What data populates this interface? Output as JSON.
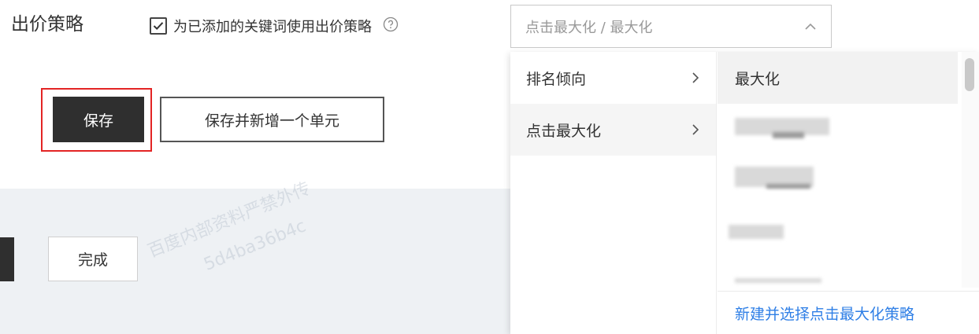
{
  "bid_strategy": {
    "section_label": "出价策略",
    "checkbox_label": "为已添加的关键词使用出价策略",
    "checkbox_checked": true,
    "select_value": "点击最大化 / 最大化"
  },
  "actions": {
    "save_label": "保存",
    "save_add_label": "保存并新增一个单元",
    "done_label": "完成"
  },
  "dropdown": {
    "categories": [
      {
        "label": "排名倾向"
      },
      {
        "label": "点击最大化"
      }
    ],
    "options": [
      {
        "label": "最大化"
      }
    ],
    "footer_link": "新建并选择点击最大化策略"
  },
  "watermark": {
    "line1": "百度内部资料严禁外传",
    "line2": "5d4ba36b4c"
  },
  "colors": {
    "primary_button": "#2f2f2f",
    "highlight": "#e32424",
    "link": "#2f7fe6",
    "band": "#eef1f4"
  }
}
